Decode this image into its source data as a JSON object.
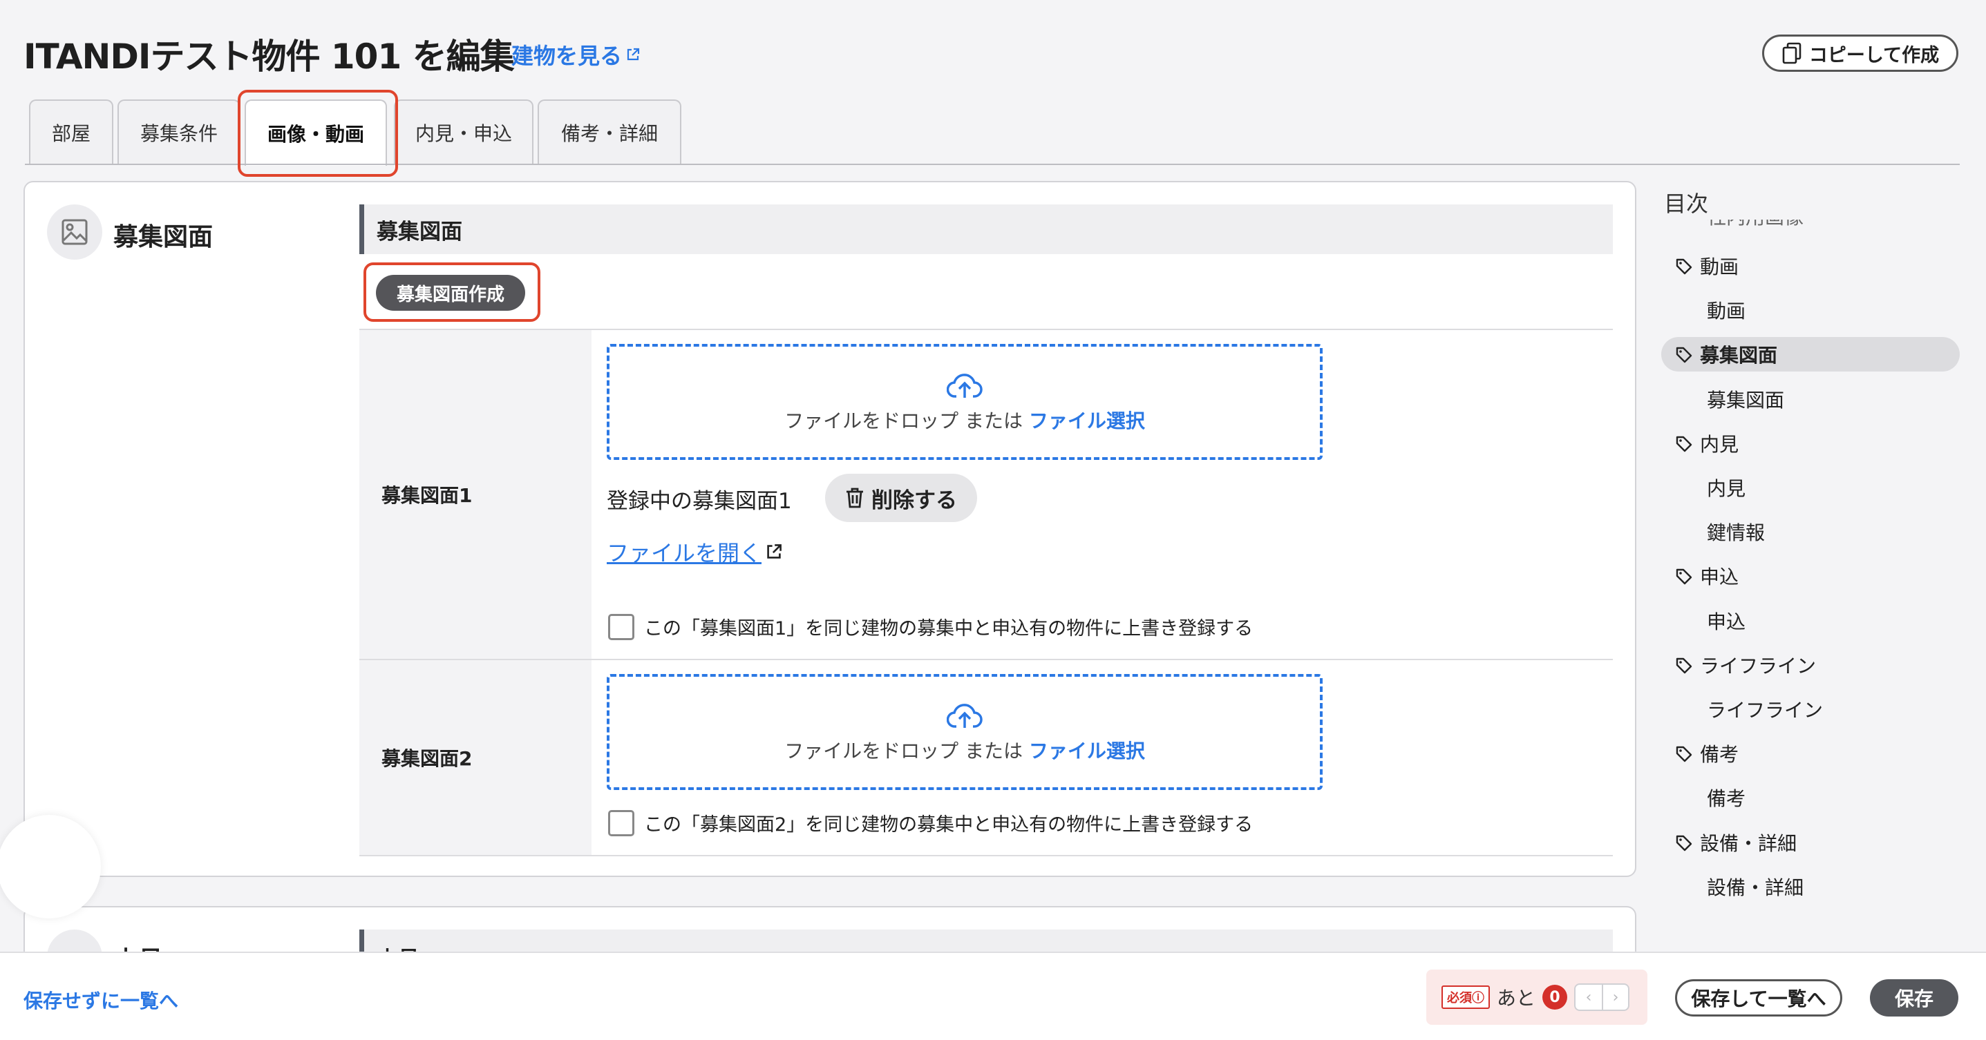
{
  "header": {
    "title": "ITANDIテスト物件 101 を編集",
    "view_building_link": "建物を見る",
    "copy_create_button": "コピーして作成"
  },
  "tabs": [
    {
      "label": "部屋",
      "active": false
    },
    {
      "label": "募集条件",
      "active": false
    },
    {
      "label": "画像・動画",
      "active": true
    },
    {
      "label": "内見・申込",
      "active": false
    },
    {
      "label": "備考・詳細",
      "active": false
    }
  ],
  "section": {
    "title": "募集図面",
    "subsection_title": "募集図面",
    "create_button": "募集図面作成",
    "next_section_title": "内見"
  },
  "figures": [
    {
      "label": "募集図面1",
      "dropzone_text": "ファイルをドロップ または ",
      "dropzone_link": "ファイル選択",
      "registered_label": "登録中の募集図面1",
      "delete_button": "削除する",
      "open_file_link": "ファイルを開く",
      "checkbox_label": "この「募集図面1」を同じ建物の募集中と申込有の物件に上書き登録する"
    },
    {
      "label": "募集図面2",
      "dropzone_text": "ファイルをドロップ または ",
      "dropzone_link": "ファイル選択",
      "checkbox_label": "この「募集図面2」を同じ建物の募集中と申込有の物件に上書き登録する"
    }
  ],
  "toc": {
    "title": "目次",
    "partial_item": "社内用画像",
    "items": [
      {
        "label": "動画",
        "type": "group",
        "active": false
      },
      {
        "label": "動画",
        "type": "sub",
        "active": false
      },
      {
        "label": "募集図面",
        "type": "group",
        "active": true
      },
      {
        "label": "募集図面",
        "type": "sub",
        "active": false
      },
      {
        "label": "内見",
        "type": "group",
        "active": false
      },
      {
        "label": "内見",
        "type": "sub",
        "active": false
      },
      {
        "label": "鍵情報",
        "type": "sub",
        "active": false
      },
      {
        "label": "申込",
        "type": "group",
        "active": false
      },
      {
        "label": "申込",
        "type": "sub",
        "active": false
      },
      {
        "label": "ライフライン",
        "type": "group",
        "active": false
      },
      {
        "label": "ライフライン",
        "type": "sub",
        "active": false
      },
      {
        "label": "備考",
        "type": "group",
        "active": false
      },
      {
        "label": "備考",
        "type": "sub",
        "active": false
      },
      {
        "label": "設備・詳細",
        "type": "group",
        "active": false
      },
      {
        "label": "設備・詳細",
        "type": "sub",
        "active": false
      }
    ]
  },
  "footer": {
    "back_link": "保存せずに一覧へ",
    "required_badge": "必須",
    "remaining_label": "あと",
    "remaining_count": "0",
    "save_and_list_button": "保存して一覧へ",
    "save_button": "保存"
  },
  "colors": {
    "accent": "#2b78e4",
    "highlight": "#e0452d",
    "required": "#d4302a",
    "primary_button": "#55575c"
  }
}
